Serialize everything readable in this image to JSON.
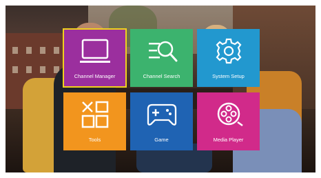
{
  "menu": {
    "tiles": [
      {
        "label": "Channel Manager",
        "icon": "monitor-icon",
        "color": "#9b2f9e",
        "selected": true
      },
      {
        "label": "Channel Search",
        "icon": "search-list-icon",
        "color": "#3cb36e",
        "selected": false
      },
      {
        "label": "System Setup",
        "icon": "gear-icon",
        "color": "#2298cf",
        "selected": false
      },
      {
        "label": "Tools",
        "icon": "tools-icon",
        "color": "#f2951e",
        "selected": false
      },
      {
        "label": "Game",
        "icon": "gamepad-icon",
        "color": "#1f63b3",
        "selected": false
      },
      {
        "label": "Media Player",
        "icon": "film-reel-icon",
        "color": "#d12a8a",
        "selected": false
      }
    ],
    "selection_color": "#f0d21c"
  }
}
